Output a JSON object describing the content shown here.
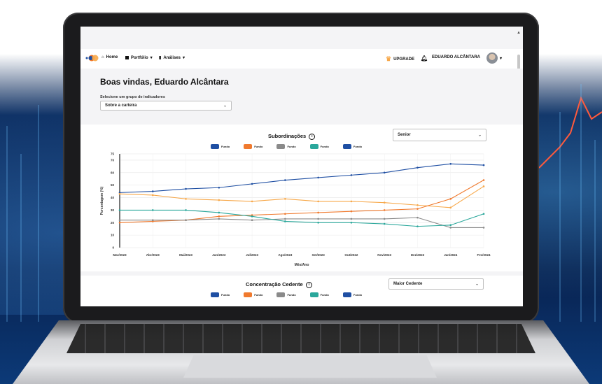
{
  "nav": {
    "home": "Home",
    "portfolio": "Portfólio",
    "analyses": "Análises",
    "upgrade": "UPGRADE",
    "user": "EDUARDO ALCÂNTARA"
  },
  "welcome": "Boas vindas, Eduardo Alcântara",
  "indicator_group": {
    "label": "Selecione um grupo de indicadores",
    "value": "Sobre a carteira"
  },
  "chart1": {
    "title": "Subordinações",
    "dropdown": "Senior"
  },
  "chart2": {
    "title": "Concentração Cedente",
    "dropdown": "Maior Cedente",
    "legend": [
      "Fundo",
      "Fundo",
      "Fundo",
      "Fundo",
      "Fundo"
    ]
  },
  "colors": {
    "blue": "#1f4fa3",
    "orange": "#f07a2e",
    "gray": "#8a8a8a",
    "teal": "#2aa79b",
    "light_orange": "#f7a84a"
  },
  "chart_data": {
    "type": "line",
    "title": "Subordinações",
    "xlabel": "Mês/Ano",
    "ylabel": "Porcentagem (%)",
    "ylim": [
      0,
      75
    ],
    "yticks": [
      0,
      10,
      20,
      30,
      40,
      50,
      60,
      70,
      75
    ],
    "categories": [
      "Mar/2023",
      "Abr/2023",
      "Mai/2023",
      "Jun/2023",
      "Jul/2023",
      "Ago/2023",
      "Set/2023",
      "Out/2022",
      "Nov/2023",
      "Dez/2023",
      "Jan/2024",
      "Fev/2024"
    ],
    "legend": [
      "Fundo",
      "Fundo",
      "Fundo",
      "Fundo",
      "Fundo"
    ],
    "legend_colors": [
      "#1f4fa3",
      "#f07a2e",
      "#8a8a8a",
      "#2aa79b",
      "#1f4fa3"
    ],
    "series": [
      {
        "color": "#1f4fa3",
        "values": [
          44,
          45,
          47,
          48,
          51,
          54,
          56,
          58,
          60,
          64,
          67,
          66
        ]
      },
      {
        "color": "#f7a84a",
        "values": [
          43,
          42,
          39,
          38,
          37,
          39,
          37,
          37,
          36,
          34,
          32,
          49
        ]
      },
      {
        "color": "#f07a2e",
        "values": [
          20,
          21,
          22,
          25,
          26,
          27,
          28,
          29,
          30,
          31,
          39,
          54
        ]
      },
      {
        "color": "#8a8a8a",
        "values": [
          22,
          22,
          22,
          23,
          22,
          23,
          23,
          23,
          23,
          24,
          16,
          16
        ]
      },
      {
        "color": "#2aa79b",
        "values": [
          30,
          30,
          30,
          28,
          25,
          21,
          20,
          20,
          19,
          17,
          18,
          27
        ]
      }
    ]
  }
}
